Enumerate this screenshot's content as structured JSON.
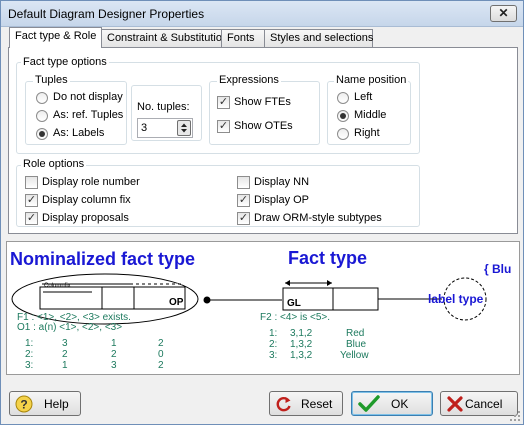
{
  "window": {
    "title": "Default Diagram Designer Properties",
    "close_glyph": "✕"
  },
  "tabs": [
    {
      "label": "Fact type & Role"
    },
    {
      "label": "Constraint & Substitution"
    },
    {
      "label": "Fonts"
    },
    {
      "label": "Styles and selections"
    }
  ],
  "fact_type_options": {
    "title": "Fact type options",
    "tuples": {
      "title": "Tuples",
      "options": [
        {
          "label": "Do not display",
          "selected": false
        },
        {
          "label": "As: ref. Tuples",
          "selected": false
        },
        {
          "label": "As: Labels",
          "selected": true
        }
      ]
    },
    "no_tuples": {
      "label": "No. tuples:",
      "value": "3"
    },
    "expressions": {
      "title": "Expressions",
      "options": [
        {
          "label": "Show FTEs",
          "checked": true
        },
        {
          "label": "Show OTEs",
          "checked": true
        }
      ]
    },
    "name_position": {
      "title": "Name position",
      "options": [
        {
          "label": "Left",
          "selected": false
        },
        {
          "label": "Middle",
          "selected": true
        },
        {
          "label": "Right",
          "selected": false
        }
      ]
    }
  },
  "role_options": {
    "title": "Role options",
    "left": [
      {
        "label": "Display role number",
        "checked": false
      },
      {
        "label": "Display column fix",
        "checked": true
      },
      {
        "label": "Display proposals",
        "checked": true
      }
    ],
    "right": [
      {
        "label": "Display NN",
        "checked": false
      },
      {
        "label": "Display OP",
        "checked": true
      },
      {
        "label": "Draw ORM-style subtypes",
        "checked": true
      }
    ]
  },
  "preview": {
    "nominalized_title": "Nominalized fact type",
    "fact_type_title": "Fact type",
    "blue_fragment": "{ Blu",
    "label_type": "label type",
    "columnfix": "Columnfix",
    "op": "OP",
    "gl": "GL",
    "f1": "F1 : <1>, <2>, <3> exists.",
    "o1": "O1 : a(n) <1>, <2>, <3>",
    "f2": "F2 : <4> is <5>.",
    "left_rows": [
      [
        "1:",
        "3",
        "1",
        "2"
      ],
      [
        "2:",
        "2",
        "2",
        "0"
      ],
      [
        "3:",
        "1",
        "3",
        "2"
      ]
    ],
    "right_rows": [
      [
        "1:",
        "3,1,2",
        "Red"
      ],
      [
        "2:",
        "1,3,2",
        "Blue"
      ],
      [
        "3:",
        "1,3,2",
        "Yellow"
      ]
    ],
    "colors": {
      "title_blue": "#1a18d4",
      "text_green": "#1d7a5e",
      "line": "#000000"
    }
  },
  "buttons": {
    "help": "Help",
    "reset": "Reset",
    "ok": "OK",
    "cancel": "Cancel"
  }
}
